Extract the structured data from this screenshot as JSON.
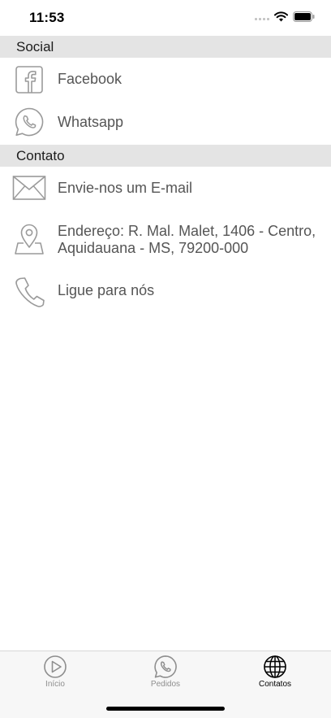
{
  "status_bar": {
    "time": "11:53"
  },
  "sections": {
    "social": {
      "title": "Social",
      "items": [
        {
          "label": "Facebook",
          "icon": "facebook-icon"
        },
        {
          "label": "Whatsapp",
          "icon": "whatsapp-icon"
        }
      ]
    },
    "contato": {
      "title": "Contato",
      "items": [
        {
          "label": "Envie-nos um E-mail",
          "icon": "mail-icon"
        },
        {
          "label": "Endereço: R. Mal. Malet, 1406 - Centro, Aquidauana - MS, 79200-000",
          "icon": "location-pin-icon"
        },
        {
          "label": "Ligue para nós",
          "icon": "phone-icon"
        }
      ]
    }
  },
  "tab_bar": {
    "active": "Contatos",
    "tabs": [
      {
        "label": "Início",
        "icon": "play-icon"
      },
      {
        "label": "Pedidos",
        "icon": "whatsapp-icon"
      },
      {
        "label": "Contatos",
        "icon": "globe-icon"
      }
    ]
  },
  "colors": {
    "section_bg": "#e4e4e4",
    "icon_stroke": "#9a9a9a",
    "text": "#555555",
    "tab_inactive": "#8e8e8e",
    "tab_active": "#000000"
  }
}
